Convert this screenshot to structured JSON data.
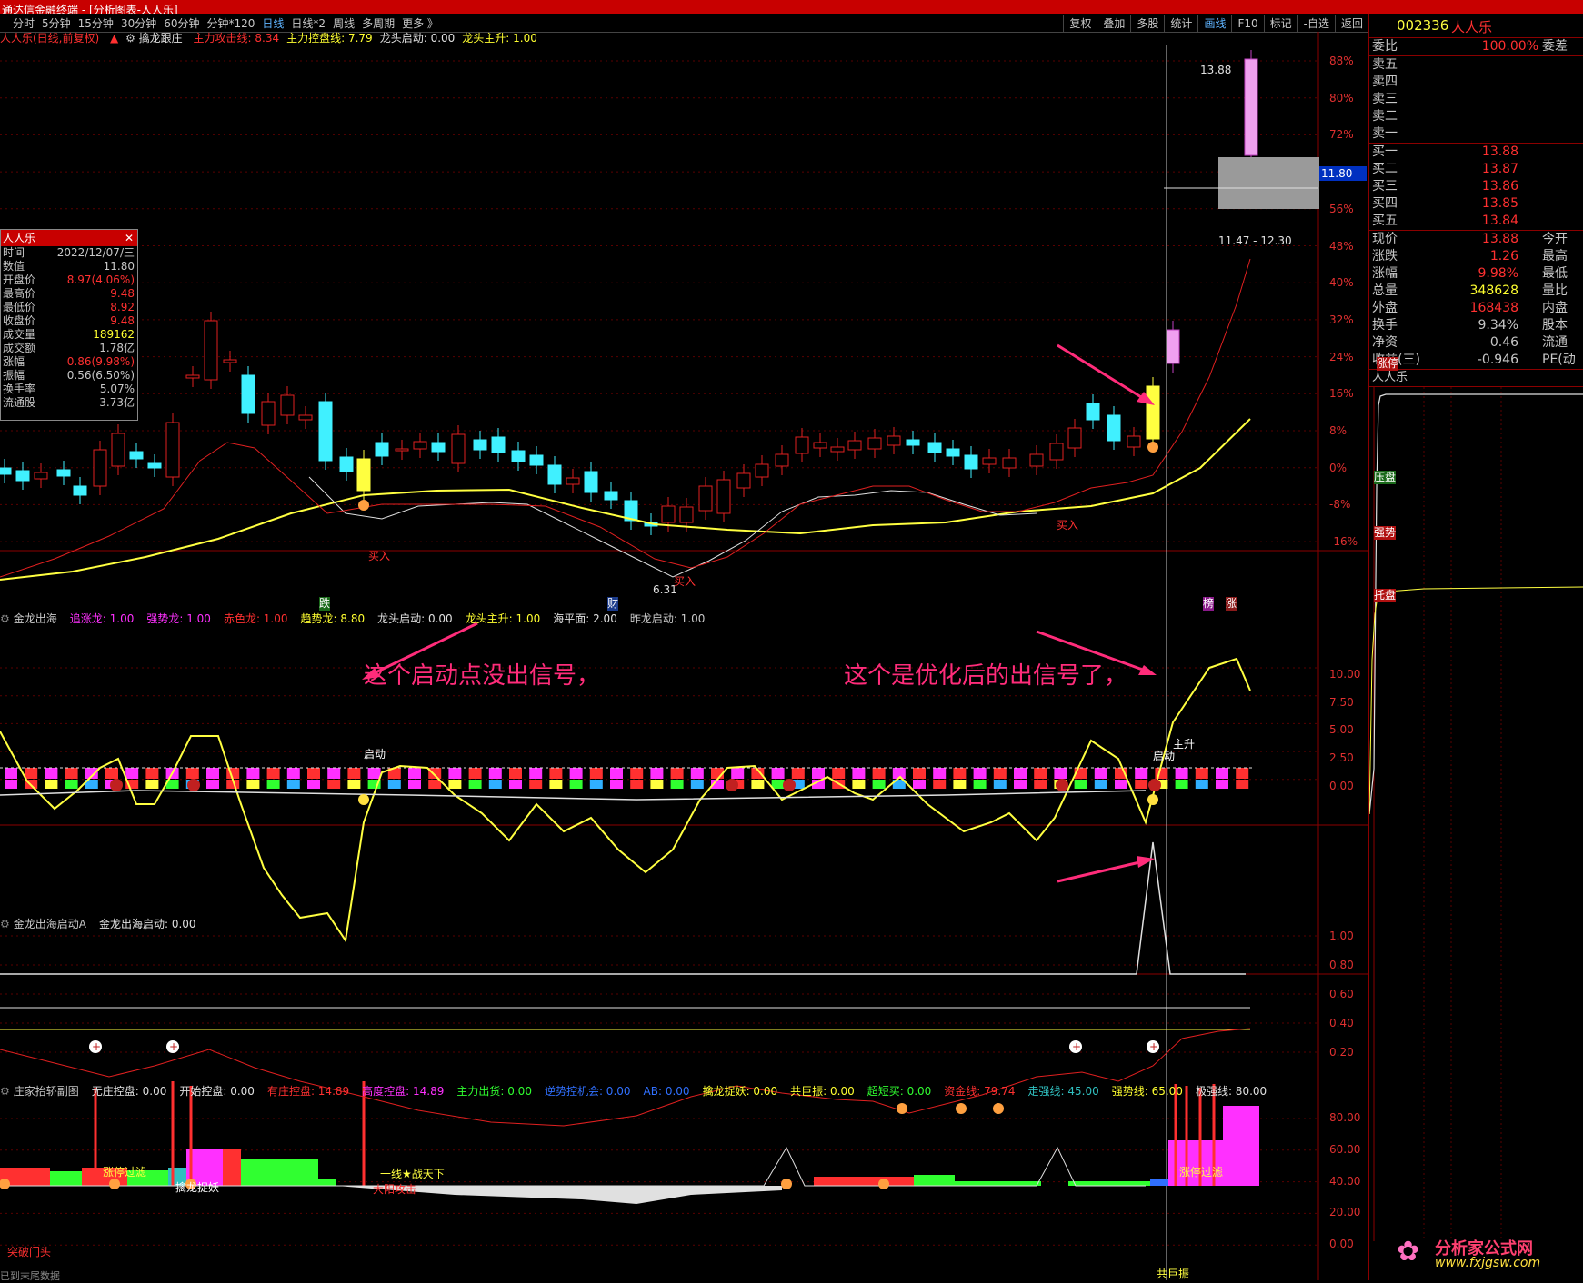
{
  "window": {
    "title": "通达信金融终端 - [分析图表-人人乐]"
  },
  "menu": {
    "periods": [
      "分时",
      "5分钟",
      "15分钟",
      "30分钟",
      "60分钟",
      "分钟*120",
      "日线",
      "日线*2",
      "周线",
      "多周期",
      "更多 》"
    ],
    "active_period": "日线",
    "tools": [
      "复权",
      "叠加",
      "多股",
      "统计",
      "画线",
      "F10",
      "标记",
      "-自选",
      "返回"
    ],
    "active_tool": "画线"
  },
  "main_chart": {
    "header": {
      "stock": "人人乐(日线,前复权)",
      "indicator": "擒龙跟庄",
      "items": [
        {
          "label": "主力攻击线:",
          "value": "8.34",
          "color": "#ff3030"
        },
        {
          "label": "主力控盘线:",
          "value": "7.79",
          "color": "#ffff30"
        },
        {
          "label": "龙头启动:",
          "value": "0.00",
          "color": "#e0e0e0"
        },
        {
          "label": "龙头主升:",
          "value": "1.00",
          "color": "#ffff30"
        }
      ]
    },
    "y_axis": [
      "88%",
      "80%",
      "72%",
      "64%",
      "56%",
      "48%",
      "40%",
      "32%",
      "24%",
      "16%",
      "8%",
      "0%",
      "-8%",
      "-16%"
    ],
    "crosshair_price": "11.80",
    "box_label": "11.47 - 12.30",
    "high_label": "13.88",
    "low_label": "6.31",
    "markers": {
      "buy1": "买入",
      "buy2": "买入",
      "buy3": "买入",
      "die": "跌",
      "cai": "财",
      "bang": "榜",
      "zhang": "涨"
    }
  },
  "info_box": {
    "title": "人人乐",
    "rows": [
      {
        "k": "时间",
        "v": "2022/12/07/三",
        "c": "#c8c8c8"
      },
      {
        "k": "数值",
        "v": "11.80",
        "c": "#c8c8c8"
      },
      {
        "k": "开盘价",
        "v": "8.97(4.06%)",
        "c": "#ff3030"
      },
      {
        "k": "最高价",
        "v": "9.48",
        "c": "#ff3030"
      },
      {
        "k": "最低价",
        "v": "8.92",
        "c": "#ff3030"
      },
      {
        "k": "收盘价",
        "v": "9.48",
        "c": "#ff3030"
      },
      {
        "k": "成交量",
        "v": "189162",
        "c": "#ffff30"
      },
      {
        "k": "成交额",
        "v": "1.78亿",
        "c": "#c8c8c8"
      },
      {
        "k": "涨幅",
        "v": "0.86(9.98%)",
        "c": "#ff3030"
      },
      {
        "k": "振幅",
        "v": "0.56(6.50%)",
        "c": "#c8c8c8"
      },
      {
        "k": "换手率",
        "v": "5.07%",
        "c": "#c8c8c8"
      },
      {
        "k": "流通股",
        "v": "3.73亿",
        "c": "#c8c8c8"
      }
    ]
  },
  "panel2": {
    "header": [
      {
        "t": "金龙出海",
        "c": "#c8c8c8"
      },
      {
        "t": "追涨龙: 1.00",
        "c": "#ff30ff"
      },
      {
        "t": "强势龙: 1.00",
        "c": "#ff30ff"
      },
      {
        "t": "赤色龙: 1.00",
        "c": "#ff3030"
      },
      {
        "t": "趋势龙: 8.80",
        "c": "#ffff30"
      },
      {
        "t": "龙头启动: 0.00",
        "c": "#e0e0e0"
      },
      {
        "t": "龙头主升: 1.00",
        "c": "#ffff30"
      },
      {
        "t": "海平面: 2.00",
        "c": "#e0e0e0"
      },
      {
        "t": "昨龙启动: 1.00",
        "c": "#c8c8c8"
      }
    ],
    "y_axis": [
      "10.00",
      "7.50",
      "5.00",
      "2.50",
      "0.00"
    ],
    "note_left": "这个启动点没出信号，",
    "note_right": "这个是优化后的出信号了，",
    "label_start": "启动",
    "label_start2": "启动",
    "label_main": "主升"
  },
  "panel3": {
    "header": [
      {
        "t": "金龙出海启动A",
        "c": "#c8c8c8"
      },
      {
        "t": "金龙出海启动: 0.00",
        "c": "#e0e0e0"
      }
    ],
    "y_axis": [
      "1.00",
      "0.80",
      "0.60",
      "0.40",
      "0.20"
    ]
  },
  "panel4": {
    "header": [
      {
        "t": "庄家抬轿副图",
        "c": "#c8c8c8"
      },
      {
        "t": "无庄控盘: 0.00",
        "c": "#e0e0e0"
      },
      {
        "t": "开始控盘: 0.00",
        "c": "#e0e0e0"
      },
      {
        "t": "有庄控盘: 14.89",
        "c": "#ff3030"
      },
      {
        "t": "高度控盘: 14.89",
        "c": "#ff30ff"
      },
      {
        "t": "主力出货: 0.00",
        "c": "#30ff30"
      },
      {
        "t": "逆势控机会: 0.00",
        "c": "#3070ff"
      },
      {
        "t": "AB: 0.00",
        "c": "#3070ff"
      },
      {
        "t": "擒龙捉妖: 0.00",
        "c": "#ffff30"
      },
      {
        "t": "共巨振: 0.00",
        "c": "#ffff30"
      },
      {
        "t": "超短买: 0.00",
        "c": "#30ff30"
      },
      {
        "t": "资金线: 79.74",
        "c": "#ff3030"
      },
      {
        "t": "走强线: 45.00",
        "c": "#30c0c0"
      },
      {
        "t": "强势线: 65.00",
        "c": "#ffff30"
      },
      {
        "t": "极强线: 80.00",
        "c": "#e0e0e0"
      }
    ],
    "y_axis": [
      "80.00",
      "60.00",
      "40.00",
      "20.00",
      "0.00"
    ],
    "labels": {
      "zt1": "涨停过滤",
      "zt2": "涨停过滤",
      "qlzy": "擒龙捉妖",
      "xian": "一线★战天下",
      "dyg": "大阳攻击",
      "tpmt": "突破门头",
      "gjz": "共巨振"
    }
  },
  "quote_panel": {
    "code": "002336",
    "name": "人人乐",
    "weibi": {
      "k": "委比",
      "v": "100.00%",
      "e": "委差"
    },
    "sell": [
      {
        "k": "卖五",
        "v": ""
      },
      {
        "k": "卖四",
        "v": ""
      },
      {
        "k": "卖三",
        "v": ""
      },
      {
        "k": "卖二",
        "v": ""
      },
      {
        "k": "卖一",
        "v": ""
      }
    ],
    "buy": [
      {
        "k": "买一",
        "v": "13.88"
      },
      {
        "k": "买二",
        "v": "13.87"
      },
      {
        "k": "买三",
        "v": "13.86"
      },
      {
        "k": "买四",
        "v": "13.85"
      },
      {
        "k": "买五",
        "v": "13.84"
      }
    ],
    "stats": [
      {
        "k": "现价",
        "v": "13.88",
        "c": "#ff3030",
        "e": "今开"
      },
      {
        "k": "涨跌",
        "v": "1.26",
        "c": "#ff3030",
        "e": "最高"
      },
      {
        "k": "涨幅",
        "v": "9.98%",
        "c": "#ff3030",
        "e": "最低"
      },
      {
        "k": "总量",
        "v": "348628",
        "c": "#ffff30",
        "e": "量比"
      },
      {
        "k": "外盘",
        "v": "168438",
        "c": "#ff3030",
        "e": "内盘"
      },
      {
        "k": "换手",
        "v": "9.34%",
        "c": "#c8c8c8",
        "e": "股本"
      },
      {
        "k": "净资",
        "v": "0.46",
        "c": "#c8c8c8",
        "e": "流通"
      },
      {
        "k": "收益(三)",
        "v": "-0.946",
        "c": "#c8c8c8",
        "e": "PE(动"
      }
    ],
    "mini_title": "人人乐",
    "mini_labels": {
      "zt": "涨停",
      "yp": "压盘",
      "qs": "强势",
      "tp": "托盘"
    }
  },
  "watermark": {
    "text": "分析家公式网",
    "url": "www.fxjgsw.com"
  },
  "bottom_text": "已到末尾数据"
}
